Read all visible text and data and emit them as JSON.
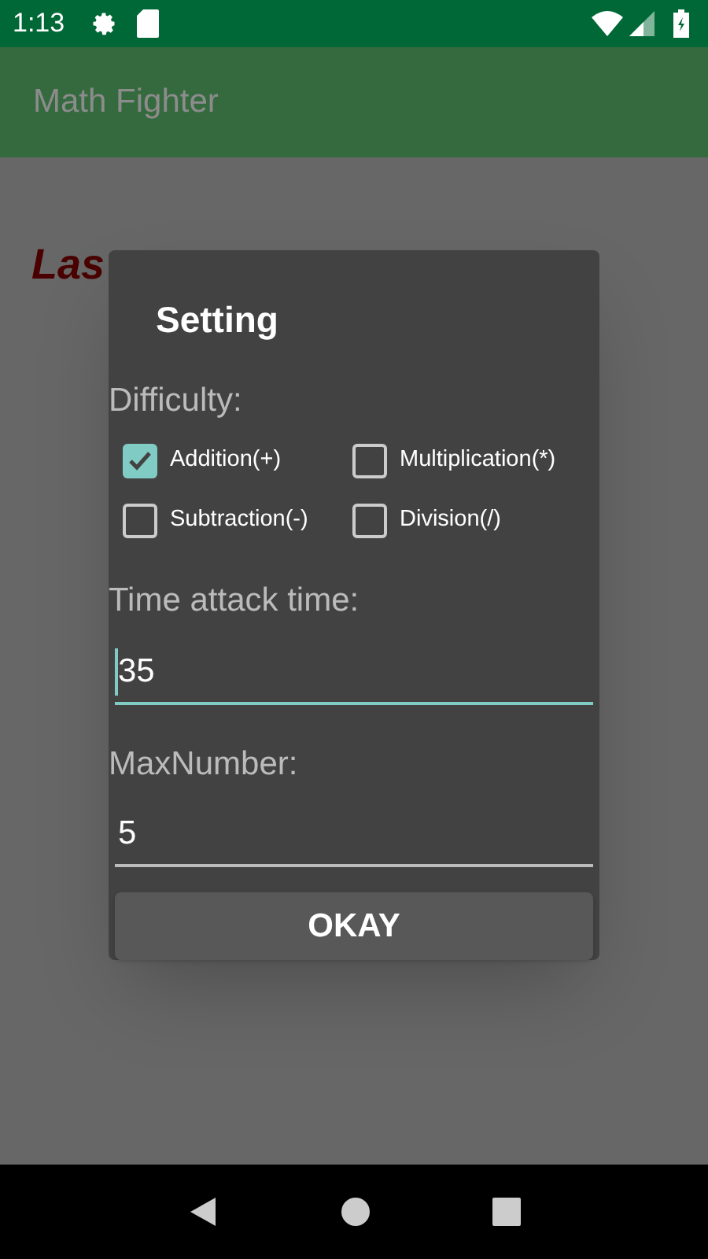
{
  "status_bar": {
    "time": "1:13"
  },
  "app_bar": {
    "title": "Math Fighter"
  },
  "score_label": "Las",
  "dialog": {
    "title": "Setting",
    "difficulty_label": "Difficulty:",
    "options": [
      {
        "label": "Addition(+)",
        "checked": true
      },
      {
        "label": "Multiplication(*)",
        "checked": false
      },
      {
        "label": "Subtraction(-)",
        "checked": false
      },
      {
        "label": "Division(/)",
        "checked": false
      }
    ],
    "fields": [
      {
        "label": "Time attack time:",
        "value": "35",
        "focused": true
      },
      {
        "label": "MaxNumber:",
        "value": "5",
        "focused": false
      }
    ],
    "button": "OKAY"
  }
}
